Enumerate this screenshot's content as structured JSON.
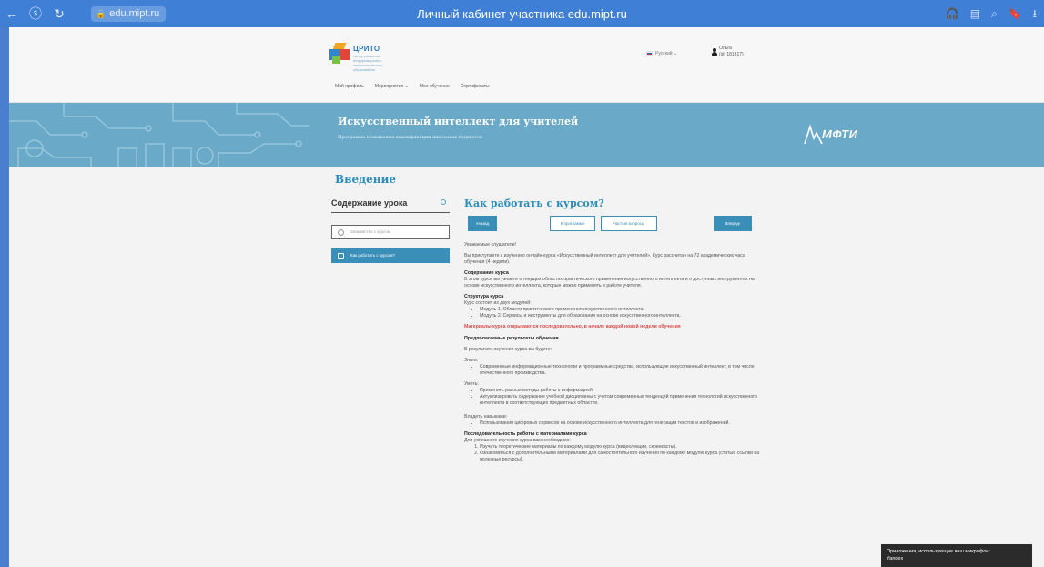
{
  "browser": {
    "back_glyph": "←",
    "shield_glyph": "ⓢ",
    "reload_glyph": "↻",
    "lock_glyph": "🔒",
    "url": "edu.mipt.ru",
    "page_title": "Личный кабинет участника edu.mipt.ru",
    "right_icons": [
      "headphones-icon",
      "reader-icon",
      "search-icon",
      "bookmark-icon",
      "downloads-icon"
    ],
    "right_glyphs": [
      "🎧",
      "▤",
      "⌕",
      "🔖",
      "⭳"
    ]
  },
  "header": {
    "brand": "ЦРИТО",
    "brand_sub": "Центр развития информационно-технологического образования",
    "language": "Русский",
    "language_caret": "⌄",
    "user_name": "Ольга",
    "user_id": "(id: 181817)",
    "nav": [
      {
        "label": "Мой профиль"
      },
      {
        "label": "Мероприятия  ⌄"
      },
      {
        "label": "Мое обучение"
      },
      {
        "label": "Сертификаты"
      }
    ]
  },
  "banner": {
    "title": "Искусственный интеллект для учителей",
    "subtitle": "Программа повышения квалификации школьных педагогов",
    "partner": "МФТИ",
    "color": "#6aaac8"
  },
  "lesson": {
    "section_title": "Введение",
    "sidebar_title": "Содержание урока",
    "sidebar_items": [
      {
        "label": "Знакомство с курсом",
        "active": false
      },
      {
        "label": "Как работать с курсом?",
        "active": true
      }
    ],
    "title": "Как работать с курсом?",
    "buttons": {
      "back": "‹Назад",
      "program": "К программе",
      "faq": "Частые вопросы",
      "next": "Вперед›"
    },
    "greeting": "Уважаемые слушатели!",
    "intro": "Вы приступаете к изучению онлайн-курса «Искусственный интеллект для учителей». Курс рассчитан на 72 академических часа обучения (4 недели).",
    "content_heading": "Содержание курса",
    "content_text": "В этом курсе вы узнаете о текущих областях практического применения искусственного интеллекта и о доступных инструментах на основе искусственного интеллекта, которые можно применять в работе учителя.",
    "structure_heading": "Структура курса",
    "structure_text": "Курс состоит из двух модулей:",
    "modules": [
      "Модуль 1. Области практического применения искусственного интеллекта.",
      "Модуль 2. Сервисы и инструменты для образования на основе искусственного интеллекта."
    ],
    "warning": "Материалы курса открываются последовательно, в начале каждой новой недели обучения",
    "results_heading": "Предполагаемые результаты обучения",
    "results_intro": "В результате изучения курса вы будете:",
    "know_label": "Знать:",
    "know_items": [
      "Современные информационные технологии и программные средства, использующие искусственный интеллект, в том числе отечественного производства."
    ],
    "can_label": "Уметь:",
    "can_items": [
      "Применять разные методы работы с информацией.",
      "Актуализировать содержание учебной дисциплины с учетом современных тенденций применения технологий искусственного интеллекта в соответствующих предметных областях."
    ],
    "skills_label": "Владеть навыками:",
    "skills_items": [
      "Использования цифровых сервисов на основе искусственного интеллекта для генерации текстов и изображений."
    ],
    "order_heading": "Последовательность работы с материалами курса",
    "order_intro": "Для успешного изучения курса вам необходимо:",
    "order_items": [
      "Изучить теоретические материалы по каждому модулю курса (видеолекции, скринкасты).",
      "Ознакомиться с дополнительными материалами для самостоятельного изучения по каждому модулю курса (статьи, ссылки на полезные ресурсы)."
    ]
  },
  "toast": {
    "line1": "Приложения, использующие ваш микрофон:",
    "line2": "Yandex"
  }
}
